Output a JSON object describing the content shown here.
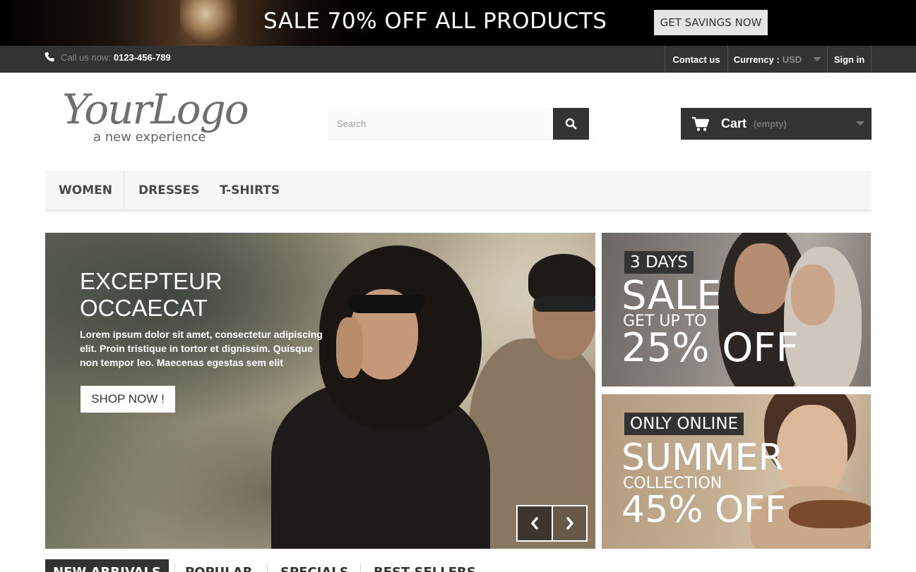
{
  "promo": {
    "text": "SALE 70% OFF ALL PRODUCTS",
    "button": "GET SAVINGS NOW"
  },
  "nav": {
    "call_label": "Call us now:",
    "phone": "0123-456-789",
    "contact": "Contact us",
    "currency_label": "Currency :",
    "currency_value": "USD",
    "sign_in": "Sign in"
  },
  "header": {
    "logo_main": "YourLogo",
    "logo_sub": "a new experience",
    "search_placeholder": "Search",
    "cart_label": "Cart",
    "cart_status": "(empty)"
  },
  "menu": {
    "items": [
      "WOMEN",
      "DRESSES",
      "T-SHIRTS"
    ]
  },
  "slider": {
    "title_line1": "EXCEPTEUR",
    "title_line2": "OCCAECAT",
    "text": "Lorem ipsum dolor sit amet, consectetur adipiscing elit. Proin tristique in tortor et dignissim. Quisque non tempor leo. Maecenas egestas sem elit",
    "button": "SHOP NOW !"
  },
  "tiles": [
    {
      "tag": "3 DAYS",
      "big": "SALE",
      "small": "GET UP TO",
      "discount": "25% OFF"
    },
    {
      "tag": "ONLY ONLINE",
      "big": "SUMMER",
      "small": "COLLECTION",
      "discount": "45% OFF"
    }
  ],
  "tabs": [
    "NEW ARRIVALS",
    "POPULAR",
    "SPECIALS",
    "BEST SELLERS"
  ],
  "colors": {
    "dark": "#333333",
    "nav_bg": "#333333",
    "menu_bg": "#f6f6f6",
    "white": "#ffffff"
  },
  "icons": [
    "phone-icon",
    "search-icon",
    "cart-icon",
    "chevron-left-icon",
    "chevron-right-icon",
    "caret-down-icon"
  ]
}
